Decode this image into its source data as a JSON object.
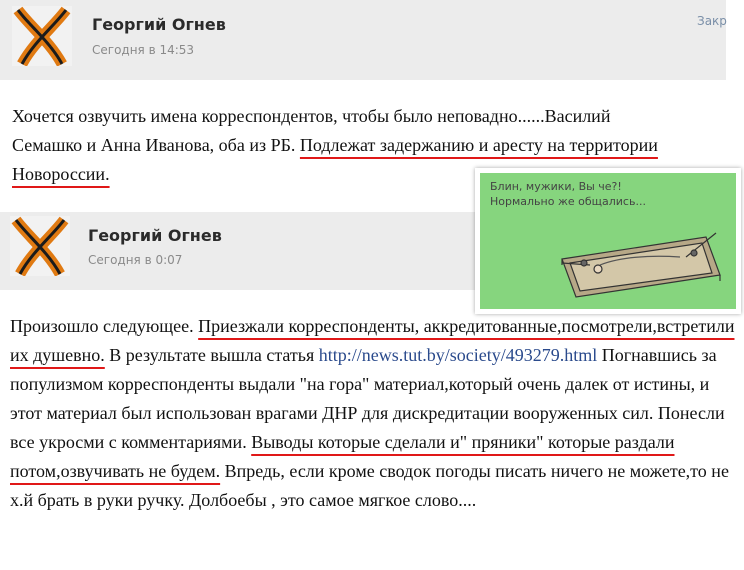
{
  "posts": [
    {
      "author": "Георгий Огнев",
      "time": "Сегодня в 14:53",
      "close_label": "Закр"
    },
    {
      "author": "Георгий Огнев",
      "time": "Сегодня в 0:07"
    }
  ],
  "post1_text": {
    "p1": "Хочется озвучить имена корреспондентов, чтобы было неповадно......Василий Семашко и Анна Иванова, оба из РБ. ",
    "u1": "Подлежат задержанию и аресту на территории Новороссии."
  },
  "post2_text": {
    "p1": "Произошло следующее. ",
    "u1": "Приезжали корреспонденты, аккредитованные,посмотрели,встретили их душевно.",
    "p2": " В результате вышла статья ",
    "link": "http://news.tut.by/society/493279.html",
    "p3": " Погнавшись за популизмом корреспонденты выдали \"на гора\" материал,который очень далек от истины, и этот материал был использован врагами ДНР для дискредитации вооруженных сил. Понесли все укросми с комментариями. ",
    "u2": "Выводы которые сделали и\" пряники\" которые раздали потом,озвучивать не будем.",
    "p4": " Впредь, если кроме сводок погоды писать ничего не можете,то не х.й брать в руки ручку. Долбоебы , это самое мягкое слово...."
  },
  "meme": {
    "caption_line1": "Блин, мужики, Вы че?!",
    "caption_line2": "Нормально же общались..."
  },
  "colors": {
    "header_bg": "#ececec",
    "underline": "#e01818",
    "link": "#2a4a8c",
    "meme_bg": "#86d57e"
  }
}
